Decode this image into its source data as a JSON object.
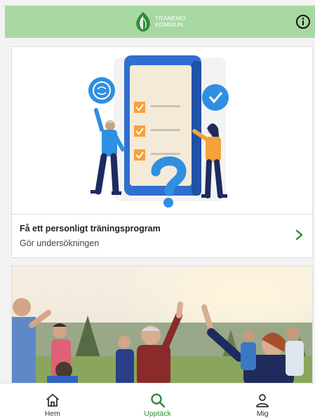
{
  "header": {
    "logo_line1": "TRANEMO",
    "logo_line2": "KOMMUN",
    "info_icon": "info-icon"
  },
  "cards": [
    {
      "title": "Få ett personligt träningsprogram",
      "subtitle": "Gör undersökningen",
      "icon": "chevron-right-icon"
    }
  ],
  "nav": {
    "items": [
      {
        "label": "Hem",
        "icon": "home-icon"
      },
      {
        "label": "Upptäck",
        "icon": "search-icon"
      },
      {
        "label": "Mig",
        "icon": "person-icon"
      }
    ],
    "active": "Upptäck"
  },
  "colors": {
    "header_bg": "#a8d8a2",
    "accent": "#2e8b3a",
    "illustration_blue": "#2f8fe0",
    "illustration_orange": "#f5a23c"
  }
}
